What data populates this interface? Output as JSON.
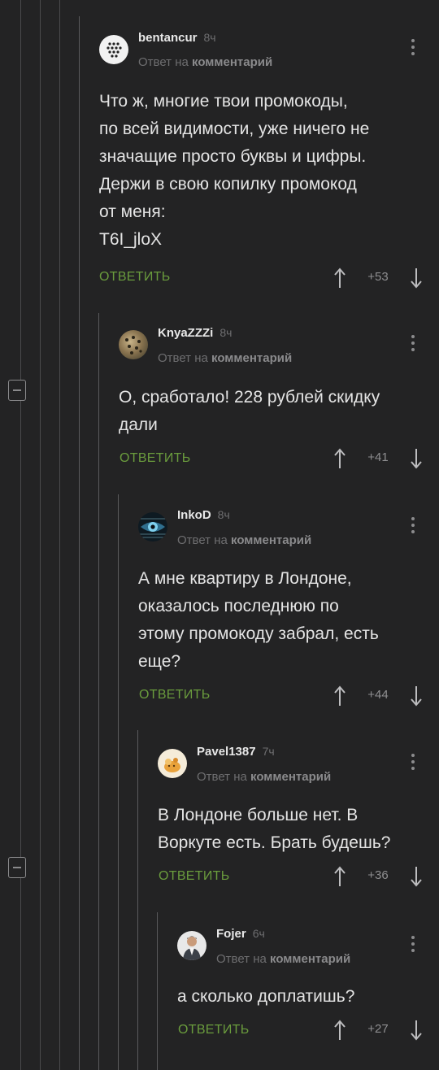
{
  "comments": [
    {
      "author": "bentancur",
      "time": "8ч",
      "reply_prefix": "Ответ на",
      "reply_target": "комментарий",
      "text_lines": [
        "Что ж, многие твои промокоды,",
        "по всей видимости, уже ничего не",
        "значащие просто буквы и цифры.",
        "Держи в свою копилку промокод",
        "от меня:",
        "T6I_jloX"
      ],
      "reply_label": "ОТВЕТИТЬ",
      "score": "+53",
      "avatar_icon": "dots-avatar-icon"
    },
    {
      "author": "KnyaZZZi",
      "time": "8ч",
      "reply_prefix": "Ответ на",
      "reply_target": "комментарий",
      "text_lines": [
        "О, сработало! 228 рублей скидку",
        "дали"
      ],
      "reply_label": "ОТВЕТИТЬ",
      "score": "+41",
      "avatar_icon": "leopard-avatar-icon"
    },
    {
      "author": "InkoD",
      "time": "8ч",
      "reply_prefix": "Ответ на",
      "reply_target": "комментарий",
      "text_lines": [
        "А мне квартиру в Лондоне,",
        "оказалось последнюю по",
        "этому промокоду забрал, есть",
        "еще?"
      ],
      "reply_label": "ОТВЕТИТЬ",
      "score": "+44",
      "avatar_icon": "eye-avatar-icon"
    },
    {
      "author": "Pavel1387",
      "time": "7ч",
      "reply_prefix": "Ответ на",
      "reply_target": "комментарий",
      "text_lines": [
        "В Лондоне больше нет. В",
        "Воркуте есть. Брать будешь?"
      ],
      "reply_label": "ОТВЕТИТЬ",
      "score": "+36",
      "avatar_icon": "cartoon-avatar-icon"
    },
    {
      "author": "Fojer",
      "time": "6ч",
      "reply_prefix": "Ответ на",
      "reply_target": "комментарий",
      "text_lines": [
        "а сколько доплатишь?"
      ],
      "reply_label": "ОТВЕТИТЬ",
      "score": "+27",
      "avatar_icon": "person-avatar-icon"
    }
  ],
  "colors": {
    "background": "#232324",
    "reply_green": "#6a9c3d",
    "muted": "#6e6e70"
  }
}
